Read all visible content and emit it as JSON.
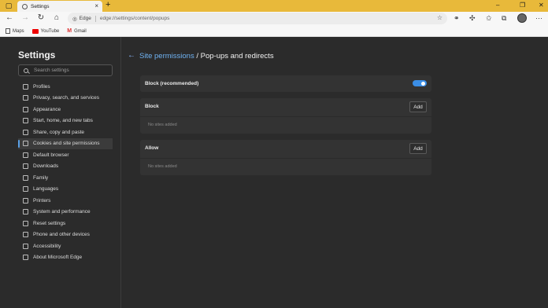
{
  "window": {
    "tab_title": "Settings",
    "new_tab": "+",
    "controls": [
      "–",
      "❐",
      "✕"
    ]
  },
  "toolbar": {
    "edge_label": "Edge",
    "url": "edge://settings/content/popups"
  },
  "favorites": [
    {
      "label": "Maps",
      "icon": "maps-icon"
    },
    {
      "label": "YouTube",
      "icon": "youtube-icon"
    },
    {
      "label": "Gmail",
      "icon": "gmail-icon"
    }
  ],
  "sidebar": {
    "title": "Settings",
    "search_placeholder": "Search settings",
    "items": [
      {
        "label": "Profiles",
        "icon": "profile-icon"
      },
      {
        "label": "Privacy, search, and services",
        "icon": "lock-icon"
      },
      {
        "label": "Appearance",
        "icon": "appearance-icon"
      },
      {
        "label": "Start, home, and new tabs",
        "icon": "home-icon"
      },
      {
        "label": "Share, copy and paste",
        "icon": "share-icon"
      },
      {
        "label": "Cookies and site permissions",
        "icon": "cookie-icon",
        "active": true
      },
      {
        "label": "Default browser",
        "icon": "browser-icon"
      },
      {
        "label": "Downloads",
        "icon": "download-icon"
      },
      {
        "label": "Family",
        "icon": "family-icon"
      },
      {
        "label": "Languages",
        "icon": "language-icon"
      },
      {
        "label": "Printers",
        "icon": "printer-icon"
      },
      {
        "label": "System and performance",
        "icon": "system-icon"
      },
      {
        "label": "Reset settings",
        "icon": "reset-icon"
      },
      {
        "label": "Phone and other devices",
        "icon": "phone-icon"
      },
      {
        "label": "Accessibility",
        "icon": "accessibility-icon"
      },
      {
        "label": "About Microsoft Edge",
        "icon": "edge-icon"
      }
    ]
  },
  "main": {
    "breadcrumb_link": "Site permissions",
    "page_title": "Pop-ups and redirects",
    "block_recommended_label": "Block (recommended)",
    "block_recommended_enabled": true,
    "block_section": {
      "label": "Block",
      "add_label": "Add",
      "empty_text": "No sites added"
    },
    "allow_section": {
      "label": "Allow",
      "add_label": "Add",
      "empty_text": "No sites added"
    }
  },
  "colors": {
    "titlebar": "#e8b93a",
    "accent": "#6fb2f2",
    "toggle_on": "#3b8ee6",
    "background": "#2b2b2b",
    "card": "#333333"
  }
}
